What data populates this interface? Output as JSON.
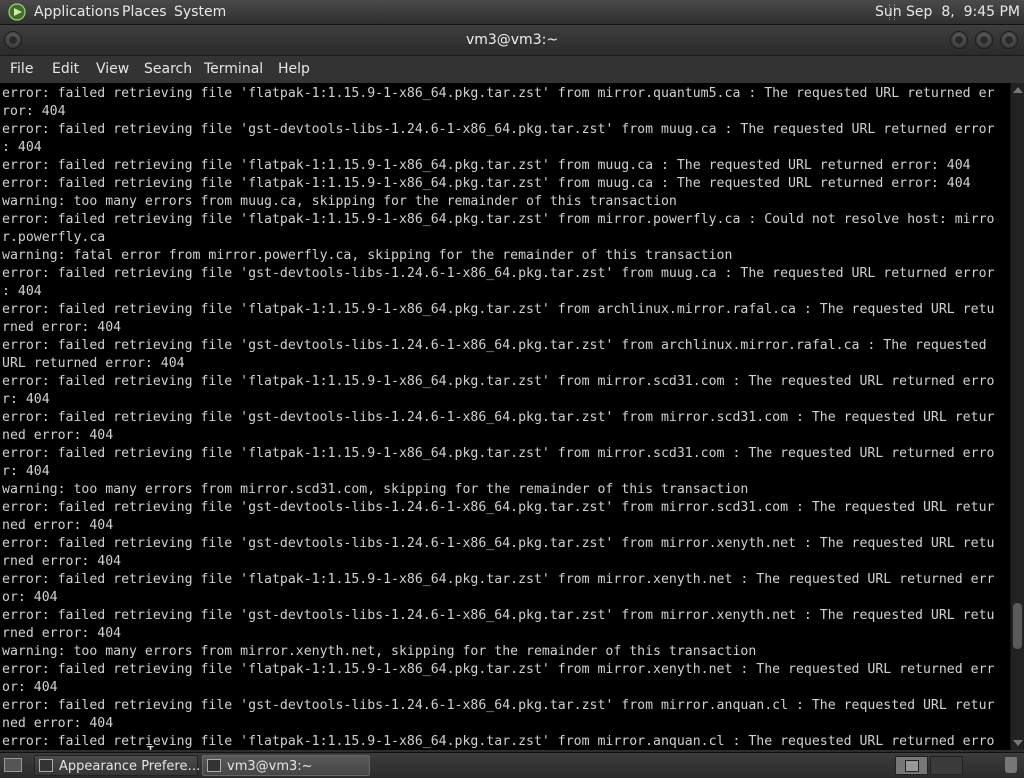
{
  "top_panel": {
    "menus": [
      "Applications",
      "Places",
      "System"
    ],
    "clock": "Sun Sep  8,  9:45 PM"
  },
  "window": {
    "title": "vm3@vm3:~",
    "menu": [
      "File",
      "Edit",
      "View",
      "Search",
      "Terminal",
      "Help"
    ]
  },
  "terminal": {
    "lines": [
      "error: failed retrieving file 'flatpak-1:1.15.9-1-x86_64.pkg.tar.zst' from mirror.quantum5.ca : The requested URL returned er",
      "ror: 404",
      "error: failed retrieving file 'gst-devtools-libs-1.24.6-1-x86_64.pkg.tar.zst' from muug.ca : The requested URL returned error",
      ": 404",
      "error: failed retrieving file 'flatpak-1:1.15.9-1-x86_64.pkg.tar.zst' from muug.ca : The requested URL returned error: 404",
      "error: failed retrieving file 'flatpak-1:1.15.9-1-x86_64.pkg.tar.zst' from muug.ca : The requested URL returned error: 404",
      "warning: too many errors from muug.ca, skipping for the remainder of this transaction",
      "error: failed retrieving file 'flatpak-1:1.15.9-1-x86_64.pkg.tar.zst' from mirror.powerfly.ca : Could not resolve host: mirro",
      "r.powerfly.ca",
      "warning: fatal error from mirror.powerfly.ca, skipping for the remainder of this transaction",
      "error: failed retrieving file 'gst-devtools-libs-1.24.6-1-x86_64.pkg.tar.zst' from muug.ca : The requested URL returned error",
      ": 404",
      "error: failed retrieving file 'flatpak-1:1.15.9-1-x86_64.pkg.tar.zst' from archlinux.mirror.rafal.ca : The requested URL retu",
      "rned error: 404",
      "error: failed retrieving file 'gst-devtools-libs-1.24.6-1-x86_64.pkg.tar.zst' from archlinux.mirror.rafal.ca : The requested",
      "URL returned error: 404",
      "error: failed retrieving file 'flatpak-1:1.15.9-1-x86_64.pkg.tar.zst' from mirror.scd31.com : The requested URL returned erro",
      "r: 404",
      "error: failed retrieving file 'gst-devtools-libs-1.24.6-1-x86_64.pkg.tar.zst' from mirror.scd31.com : The requested URL retur",
      "ned error: 404",
      "error: failed retrieving file 'flatpak-1:1.15.9-1-x86_64.pkg.tar.zst' from mirror.scd31.com : The requested URL returned erro",
      "r: 404",
      "warning: too many errors from mirror.scd31.com, skipping for the remainder of this transaction",
      "error: failed retrieving file 'gst-devtools-libs-1.24.6-1-x86_64.pkg.tar.zst' from mirror.scd31.com : The requested URL retur",
      "ned error: 404",
      "error: failed retrieving file 'gst-devtools-libs-1.24.6-1-x86_64.pkg.tar.zst' from mirror.xenyth.net : The requested URL retu",
      "rned error: 404",
      "error: failed retrieving file 'flatpak-1:1.15.9-1-x86_64.pkg.tar.zst' from mirror.xenyth.net : The requested URL returned err",
      "or: 404",
      "error: failed retrieving file 'gst-devtools-libs-1.24.6-1-x86_64.pkg.tar.zst' from mirror.xenyth.net : The requested URL retu",
      "rned error: 404",
      "warning: too many errors from mirror.xenyth.net, skipping for the remainder of this transaction",
      "error: failed retrieving file 'flatpak-1:1.15.9-1-x86_64.pkg.tar.zst' from mirror.xenyth.net : The requested URL returned err",
      "or: 404",
      "error: failed retrieving file 'gst-devtools-libs-1.24.6-1-x86_64.pkg.tar.zst' from mirror.anquan.cl : The requested URL retur",
      "ned error: 404",
      "error: failed retrieving file 'flatpak-1:1.15.9-1-x86_64.pkg.tar.zst' from mirror.anquan.cl : The requested URL returned erro"
    ]
  },
  "taskbar": {
    "tasks": [
      {
        "label": "Appearance Prefere…",
        "icon": "appearance-icon",
        "active": false
      },
      {
        "label": "vm3@vm3:~",
        "icon": "terminal-icon",
        "active": true
      }
    ]
  },
  "colors": {
    "terminal_bg": "#000000",
    "terminal_fg": "#d0d0d0",
    "panel_bg": "#3a3a3a"
  }
}
